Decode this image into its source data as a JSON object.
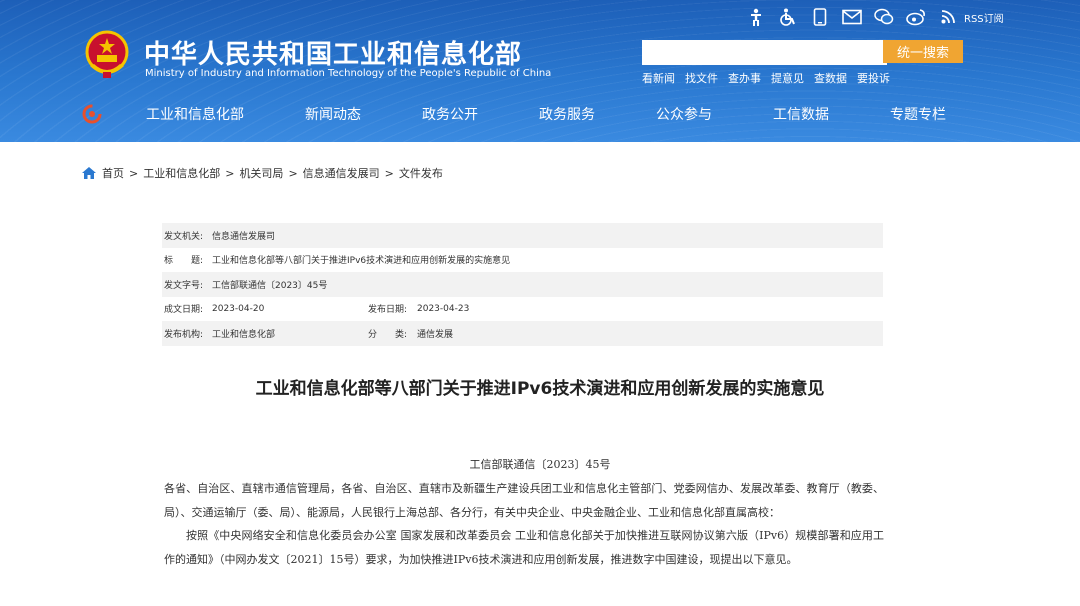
{
  "header": {
    "title": "中华人民共和国工业和信息化部",
    "subtitle": "Ministry of Industry and Information Technology of the People's Republic of China",
    "top_icons": [
      "accessibility-person-icon",
      "wheelchair-icon",
      "mobile-icon",
      "mail-icon",
      "wechat-icon",
      "weibo-icon",
      "rss-icon"
    ],
    "rss_label": "RSS订阅",
    "search": {
      "value": "",
      "button": "统一搜索"
    },
    "quick_links": [
      "看新闻",
      "找文件",
      "查办事",
      "提意见",
      "查数据",
      "要投诉"
    ],
    "nav": [
      "工业和信息化部",
      "新闻动态",
      "政务公开",
      "政务服务",
      "公众参与",
      "工信数据",
      "专题专栏"
    ]
  },
  "breadcrumb": [
    "首页",
    "工业和信息化部",
    "机关司局",
    "信息通信发展司",
    "文件发布"
  ],
  "meta": {
    "issuer_label": "发文机关:",
    "issuer": "信息通信发展司",
    "title_label": "标　　题:",
    "title": "工业和信息化部等八部门关于推进IPv6技术演进和应用创新发展的实施意见",
    "docno_label": "发文字号:",
    "docno": "工信部联通信〔2023〕45号",
    "created_label": "成文日期:",
    "created": "2023-04-20",
    "published_label": "发布日期:",
    "published": "2023-04-23",
    "org_label": "发布机构:",
    "org": "工业和信息化部",
    "category_label": "分　　类:",
    "category": "通信发展"
  },
  "article": {
    "title": "工业和信息化部等八部门关于推进IPv6技术演进和应用创新发展的实施意见",
    "doc_number": "工信部联通信〔2023〕45号",
    "recipients": "各省、自治区、直辖市通信管理局，各省、自治区、直辖市及新疆生产建设兵团工业和信息化主管部门、党委网信办、发展改革委、教育厅（教委、局）、交通运输厅（委、局）、能源局，人民银行上海总部、各分行，有关中央企业、中央金融企业、工业和信息化部直属高校：",
    "paragraph1": "按照《中央网络安全和信息化委员会办公室 国家发展和改革委员会 工业和信息化部关于加快推进互联网协议第六版（IPv6）规模部署和应用工作的通知》（中网办发文〔2021〕15号）要求，为加快推进IPv6技术演进和应用创新发展，推进数字中国建设，现提出以下意见。"
  },
  "colors": {
    "header_blue": "#2a78d0",
    "search_orange": "#f0a532",
    "meta_shade": "#f2f2f2"
  }
}
